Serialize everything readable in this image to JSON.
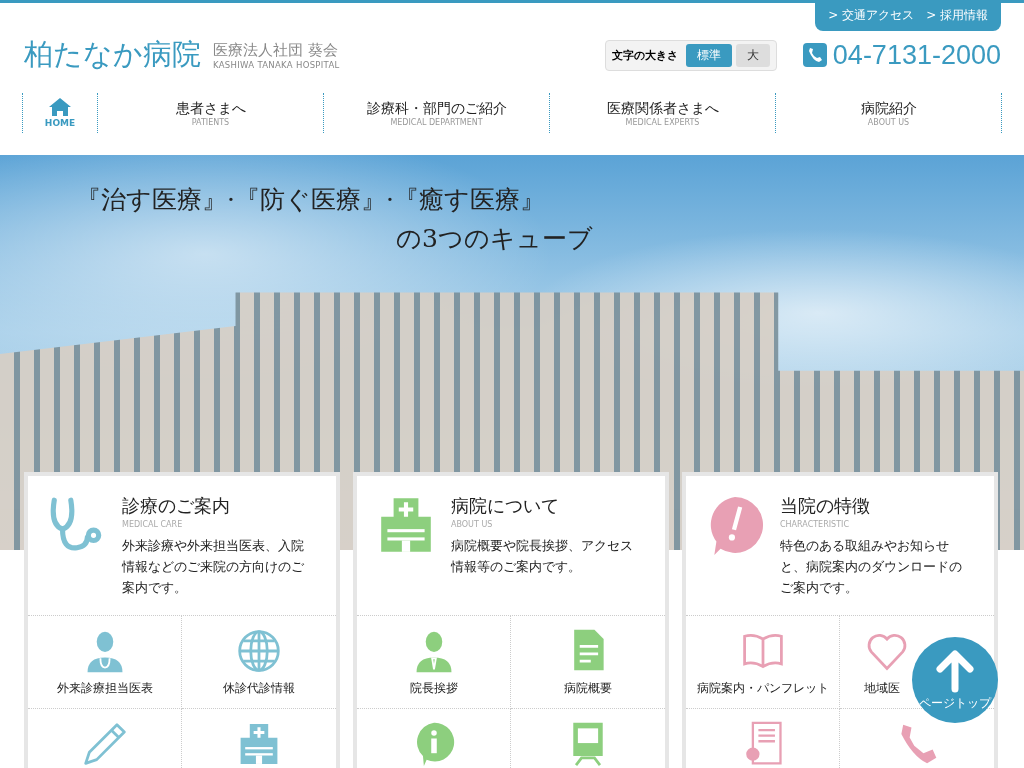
{
  "top_links": [
    "> 交通アクセス",
    "> 採用情報"
  ],
  "logo": {
    "name": "柏たなか病院",
    "org": "医療法人社団 葵会",
    "org_en": "KASHIWA TANAKA HOSPITAL"
  },
  "font_size": {
    "label": "文字の大きさ",
    "options": [
      {
        "label": "標準",
        "selected": true
      },
      {
        "label": "大",
        "selected": false
      }
    ]
  },
  "phone": "04-7131-2000",
  "nav": [
    {
      "label": "HOME",
      "kind": "home"
    },
    {
      "label": "患者さまへ",
      "sub": "PATIENTS",
      "kind": "text"
    },
    {
      "label": "診療科・部門のご紹介",
      "sub": "MEDICAL DEPARTMENT",
      "kind": "text"
    },
    {
      "label": "医療関係者さまへ",
      "sub": "MEDICAL EXPERTS",
      "kind": "text"
    },
    {
      "label": "病院紹介",
      "sub": "ABOUT US",
      "kind": "text"
    }
  ],
  "hero": {
    "line_1": "『治す医療』·『防ぐ医療』·『癒す医療』",
    "line_2": "の3つのキューブ"
  },
  "cards": [
    {
      "title": "診療のご案内",
      "sub": "MEDICAL CARE",
      "text": "外来診療や外来担当医表、入院情報などのご来院の方向けのご案内です。",
      "color": "#7fc1d3",
      "links": [
        {
          "label": "外来診療担当医表",
          "kind": "labeled"
        },
        {
          "label": "休診代診情報",
          "kind": "labeled"
        },
        {
          "kind": "icon"
        },
        {
          "kind": "icon"
        }
      ]
    },
    {
      "title": "病院について",
      "sub": "ABOUT US",
      "text": "病院概要や院長挨拶、アクセス情報等のご案内です。",
      "color": "#8dcf7e",
      "links": [
        {
          "label": "院長挨拶",
          "kind": "labeled"
        },
        {
          "label": "病院概要",
          "kind": "labeled"
        },
        {
          "kind": "icon"
        },
        {
          "kind": "icon"
        }
      ]
    },
    {
      "title": "当院の特徴",
      "sub": "CHARACTERISTIC",
      "text": "特色のある取組みやお知らせと、病院案内のダウンロードのご案内です。",
      "color": "#e8a0b4",
      "links": [
        {
          "label": "病院案内・パンフレット",
          "kind": "labeled"
        },
        {
          "label": "地域医",
          "kind": "covered"
        },
        {
          "kind": "icon"
        },
        {
          "kind": "icon"
        }
      ]
    }
  ],
  "page_top": "ページトップ"
}
